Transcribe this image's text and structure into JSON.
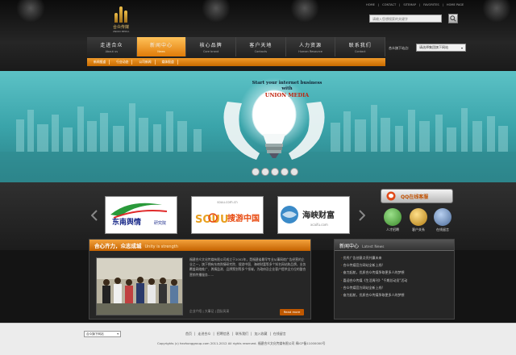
{
  "logo": {
    "name": "合众传媒",
    "sub": "UNION MEDIA"
  },
  "toplinks": [
    "HOME",
    "|",
    "CONTACT",
    "|",
    "SITEMAP",
    "|",
    "FAVORITES",
    "|",
    "HOME PAGE"
  ],
  "search": {
    "placeholder": "请输入您想搜索的关键字"
  },
  "nav": [
    {
      "cn": "走进合众",
      "en": "About us"
    },
    {
      "cn": "新闻中心",
      "en": "News"
    },
    {
      "cn": "核心品牌",
      "en": "Core brand"
    },
    {
      "cn": "客户天地",
      "en": "Contacts"
    },
    {
      "cn": "人力资源",
      "en": "Human Resource"
    },
    {
      "cn": "联系我们",
      "en": "Contact"
    }
  ],
  "group": {
    "label": "合众旗下站点:",
    "selected": "请选择集团旗下网站"
  },
  "subnav": [
    "新闻报道",
    "行业动态",
    "公司新闻",
    "媒体报道"
  ],
  "banner": {
    "line1": "Start your internet business",
    "line2": "with",
    "line3": "UNION MEDIA"
  },
  "partners": [
    {
      "name": "东南舆情",
      "sub": "研究院"
    },
    {
      "name": "搜游中国",
      "sub": "SOUU",
      "url": "souu.com.cn"
    },
    {
      "name": "海峡财富",
      "sub": "",
      "url": "xcaifu.com"
    }
  ],
  "online": {
    "label": "QQ在线客服"
  },
  "quick": [
    {
      "label": "人才招聘",
      "color": "#4aa83a"
    },
    {
      "label": "客户关系",
      "color": "#d8a22a"
    },
    {
      "label": "在线留言",
      "color": "#5a7aa8"
    }
  ],
  "about": {
    "title": "合心齐力，众志成城",
    "title_en": "Unity is strength",
    "text": "福建合众文化传媒有限公司成立于2002年，是福建省最早专业从事网络广告经营的企业之一，旗下拥有东南舆情研究院、搜游中国、海峡财富等多个知名网站和品牌，业务覆盖网络推广、舆情监测、品牌策划等多个领域，为政府及企业客户提供全方位的整合营销传播服务……",
    "links": "企业介绍 | 大事记 | 团队风采",
    "readmore": "Read more"
  },
  "news": {
    "title": "新闻中心",
    "title_en": "Latest News",
    "items": [
      "优秀广告创意点亮共赢未来",
      "合众传媒官方网站全新上线!",
      "奋力起航，优质合众传媒争取更多人的梦想",
      "喜迎合众传媒《生活周刊》\"千期总动员\"活动",
      "合众传媒官方网站全新上线!",
      "奋力起航，优质合众传媒争取更多人的梦想"
    ]
  },
  "footer": {
    "select": "合众旗下网站",
    "links": [
      "首页",
      "走进合众",
      "招聘信息",
      "联系我们",
      "加入收藏",
      "在线留言"
    ],
    "copyright": "Copyrights (c) hezhonggroup.com 2011-2012 All rights reserved.  福建合众文化传媒有限公司  闽ICP备11000000号"
  },
  "colors": {
    "accent": "#f08c1a",
    "banner": "#3aa4aa",
    "dark": "#1c1c1c"
  }
}
